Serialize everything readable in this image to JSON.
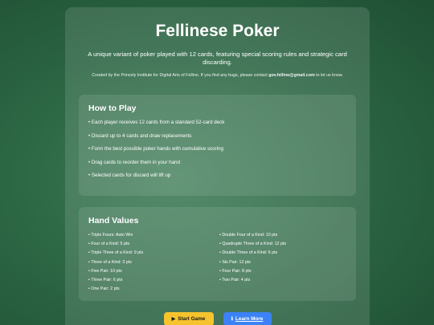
{
  "header": {
    "title": "Fellinese Poker",
    "subtitle": "A unique variant of poker played with 12 cards, featuring special scoring rules and strategic card discarding.",
    "credits_prefix": "Created by the Princely Institute for Digital Arts of Fellino. If you find any bugs, please contact ",
    "credits_email": "gov.fellino@gmail.com",
    "credits_suffix": " to let us know."
  },
  "how_to_play": {
    "heading": "How to Play",
    "items": [
      "• Each player receives 12 cards from a standard 52-card deck",
      "• Discard up to 4 cards and draw replacements",
      "• Form the best possible poker hands with cumulative scoring",
      "• Drag cards to reorder them in your hand",
      "• Selected cards for discard will lift up"
    ]
  },
  "hand_values": {
    "heading": "Hand Values",
    "left": [
      "• Triple Fours: Auto Win",
      "• Four of a Kind: 5 pts",
      "• Triple Three of a Kind: 9 pts",
      "• Three of a Kind: 3 pts",
      "• Five Pair: 10 pts",
      "• Three Pair: 6 pts",
      "• One Pair: 2 pts"
    ],
    "right": [
      "• Double Four of a Kind: 10 pts",
      "• Quadruple Three of a Kind: 12 pts",
      "• Double Three of a Kind: 6 pts",
      "• Six Pair: 12 pts",
      "• Four Pair: 8 pts",
      "• Two Pair: 4 pts"
    ]
  },
  "buttons": {
    "start_icon": "▶",
    "start_label": "Start Game",
    "learn_icon": "ℹ",
    "learn_label": "Learn More"
  },
  "colors": {
    "background": "#2c6744",
    "start_button": "#f6c32e",
    "learn_button": "#3b82f6"
  }
}
